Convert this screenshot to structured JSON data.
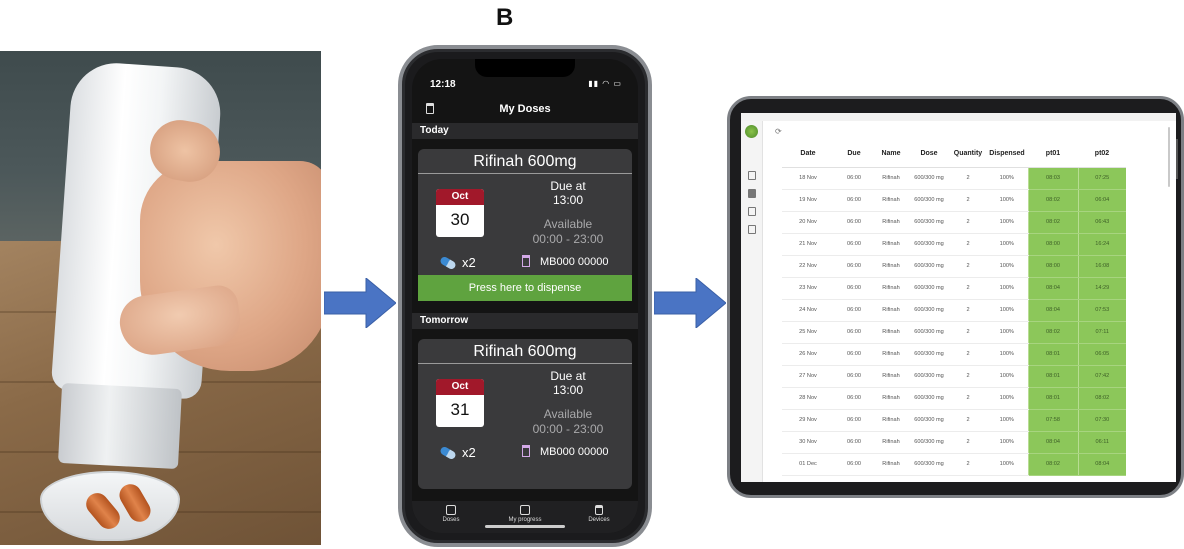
{
  "figure": {
    "panel_label": "B"
  },
  "photo": {
    "subject": "pill bottle dispensing into cap"
  },
  "colors": {
    "accent_green": "#5fa33f",
    "calendar_red": "#a1182a",
    "table_green": "#8cc75a",
    "phone_bg": "#141414"
  },
  "phone": {
    "status_time": "12:18",
    "nav_title": "My Doses",
    "sections": [
      {
        "header": "Today",
        "card": {
          "title": "Rifinah 600mg",
          "cal_month": "Oct",
          "cal_day": "30",
          "due_label": "Due at",
          "due_time": "13:00",
          "avail_label": "Available",
          "avail_window": "00:00 - 23:00",
          "quantity": "x2",
          "device_id": "MB000 00000",
          "button_label": "Press here to dispense"
        }
      },
      {
        "header": "Tomorrow",
        "card": {
          "title": "Rifinah 600mg",
          "cal_month": "Oct",
          "cal_day": "31",
          "due_label": "Due at",
          "due_time": "13:00",
          "avail_label": "Available",
          "avail_window": "00:00 - 23:00",
          "quantity": "x2",
          "device_id": "MB000 00000"
        }
      }
    ],
    "tabs": [
      {
        "label": "Doses",
        "icon": "calendar-icon"
      },
      {
        "label": "My progress",
        "icon": "chart-icon"
      },
      {
        "label": "Devices",
        "icon": "cup-icon"
      }
    ]
  },
  "tablet": {
    "columns": [
      "Date",
      "Due",
      "Name",
      "Dose",
      "Quantity",
      "Dispensed",
      "pt01",
      "pt02"
    ],
    "rows": [
      [
        "18 Nov",
        "06:00",
        "Rifinah",
        "600/300 mg",
        "2",
        "100%",
        "08:03",
        "07:25"
      ],
      [
        "19 Nov",
        "06:00",
        "Rifinah",
        "600/300 mg",
        "2",
        "100%",
        "08:02",
        "06:04"
      ],
      [
        "20 Nov",
        "06:00",
        "Rifinah",
        "600/300 mg",
        "2",
        "100%",
        "08:02",
        "06:43"
      ],
      [
        "21 Nov",
        "06:00",
        "Rifinah",
        "600/300 mg",
        "2",
        "100%",
        "08:00",
        "16:24"
      ],
      [
        "22 Nov",
        "06:00",
        "Rifinah",
        "600/300 mg",
        "2",
        "100%",
        "08:00",
        "16:08"
      ],
      [
        "23 Nov",
        "06:00",
        "Rifinah",
        "600/300 mg",
        "2",
        "100%",
        "08:04",
        "14:29"
      ],
      [
        "24 Nov",
        "06:00",
        "Rifinah",
        "600/300 mg",
        "2",
        "100%",
        "08:04",
        "07:53"
      ],
      [
        "25 Nov",
        "06:00",
        "Rifinah",
        "600/300 mg",
        "2",
        "100%",
        "08:02",
        "07:11"
      ],
      [
        "26 Nov",
        "06:00",
        "Rifinah",
        "600/300 mg",
        "2",
        "100%",
        "08:01",
        "06:05"
      ],
      [
        "27 Nov",
        "06:00",
        "Rifinah",
        "600/300 mg",
        "2",
        "100%",
        "08:01",
        "07:42"
      ],
      [
        "28 Nov",
        "06:00",
        "Rifinah",
        "600/300 mg",
        "2",
        "100%",
        "08:01",
        "08:02"
      ],
      [
        "29 Nov",
        "06:00",
        "Rifinah",
        "600/300 mg",
        "2",
        "100%",
        "07:58",
        "07:30"
      ],
      [
        "30 Nov",
        "06:00",
        "Rifinah",
        "600/300 mg",
        "2",
        "100%",
        "08:04",
        "06:11"
      ],
      [
        "01 Dec",
        "06:00",
        "Rifinah",
        "600/300 mg",
        "2",
        "100%",
        "08:02",
        "08:04"
      ]
    ]
  }
}
